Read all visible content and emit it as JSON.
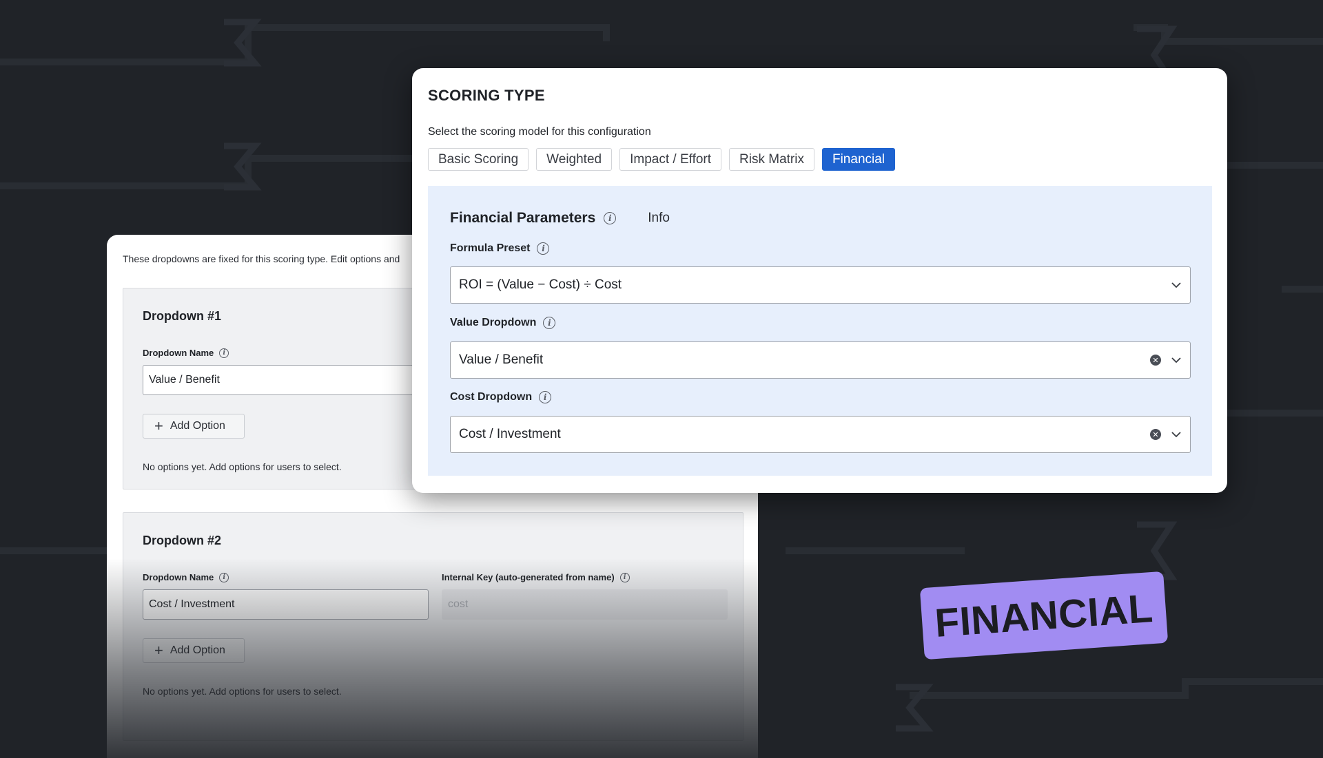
{
  "background": {
    "color": "#202328"
  },
  "back_card": {
    "note": "These dropdowns are fixed for this scoring type. Edit options and",
    "dropdowns": [
      {
        "title": "Dropdown #1",
        "name_label": "Dropdown Name",
        "name_value": "Value / Benefit",
        "add_option_label": "Add Option",
        "empty_text": "No options yet. Add options for users to select."
      },
      {
        "title": "Dropdown #2",
        "name_label": "Dropdown Name",
        "name_value": "Cost / Investment",
        "key_label": "Internal Key (auto-generated from name)",
        "key_value": "cost",
        "add_option_label": "Add Option",
        "empty_text": "No options yet. Add options for users to select."
      }
    ]
  },
  "scoring": {
    "title": "SCORING TYPE",
    "subtitle": "Select the scoring model for this configuration",
    "tabs": [
      "Basic Scoring",
      "Weighted",
      "Impact / Effort",
      "Risk Matrix",
      "Financial"
    ],
    "active_tab": "Financial",
    "accent_color": "#1e63d0"
  },
  "financial": {
    "title": "Financial Parameters",
    "info_label": "Info",
    "formula_label": "Formula Preset",
    "formula_value": "ROI = (Value − Cost) ÷ Cost",
    "value_label": "Value Dropdown",
    "value_value": "Value / Benefit",
    "cost_label": "Cost Dropdown",
    "cost_value": "Cost / Investment",
    "panel_color": "#e7effc"
  },
  "badge": {
    "text": "FINANCIAL",
    "color": "#a18cf2"
  }
}
